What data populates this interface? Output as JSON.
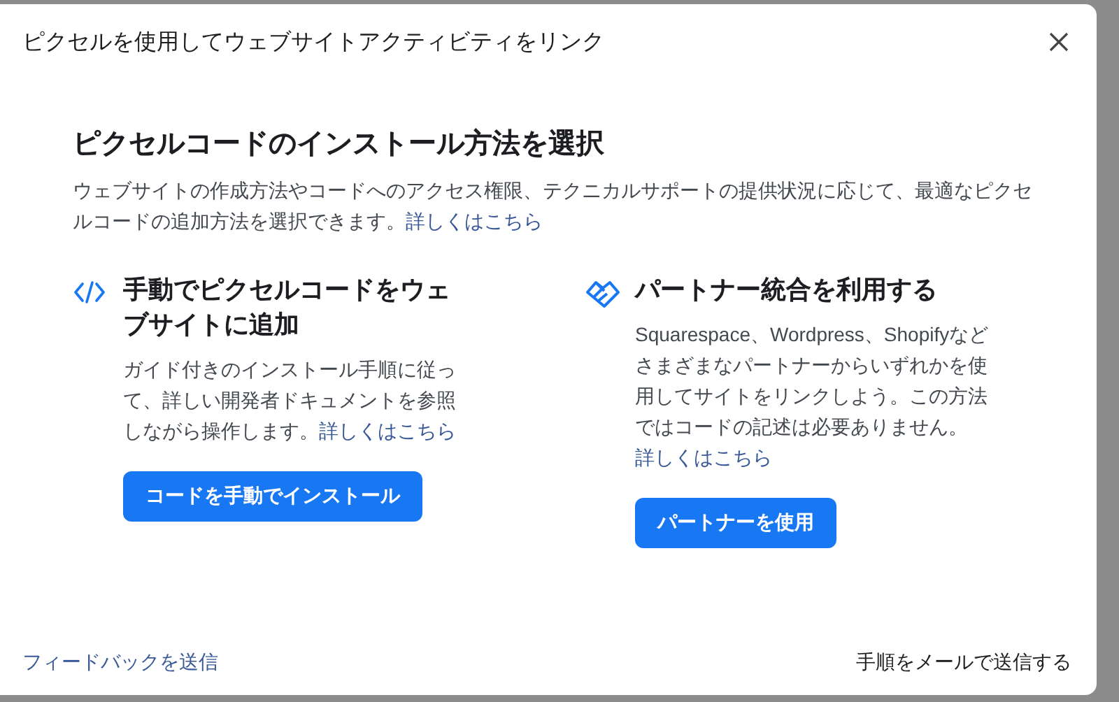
{
  "dialog": {
    "title": "ピクセルを使用してウェブサイトアクティビティをリンク"
  },
  "heading": "ピクセルコードのインストール方法を選択",
  "intro": {
    "text": "ウェブサイトの作成方法やコードへのアクセス権限、テクニカルサポートの提供状況に応じて、最適なピクセルコードの追加方法を選択できます。",
    "link": "詳しくはこちら"
  },
  "options": [
    {
      "kind": "code",
      "title": "手動でピクセルコードをウェブサイトに追加",
      "text": "ガイド付きのインストール手順に従って、詳しい開発者ドキュメントを参照しながら操作します。",
      "link": "詳しくはこちら",
      "button": "コードを手動でインストール"
    },
    {
      "kind": "partner",
      "title": "パートナー統合を利用する",
      "text": "Squarespace、Wordpress、Shopifyなどさまざまなパートナーからいずれかを使用してサイトをリンクしよう。この方法ではコードの記述は必要ありません。",
      "link": "詳しくはこちら",
      "button": "パートナーを使用"
    }
  ],
  "footer": {
    "feedback": "フィードバックを送信",
    "email": "手順をメールで送信する"
  }
}
